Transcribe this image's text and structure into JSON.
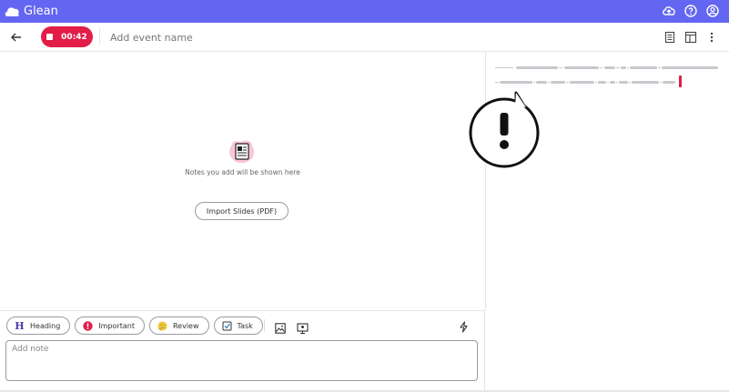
{
  "app": {
    "name": "Glean",
    "brand_color": "#6366f1"
  },
  "topbar": {
    "icons": [
      "cloud-upload-icon",
      "help-icon",
      "account-icon"
    ]
  },
  "toolbar": {
    "recording_time": "00:42",
    "recording_color": "#e11d48",
    "event_placeholder": "Add event name",
    "icons": [
      "back-arrow-icon",
      "notes-panel-icon",
      "layout-icon",
      "more-icon"
    ]
  },
  "notes": {
    "empty_message": "Notes you add will be shown here",
    "import_label": "Import Slides (PDF)"
  },
  "composer": {
    "chips": [
      {
        "label": "Heading",
        "icon": "heading-icon"
      },
      {
        "label": "Important",
        "icon": "important-icon"
      },
      {
        "label": "Review",
        "icon": "thinking-face-icon"
      },
      {
        "label": "Task",
        "icon": "task-checkbox-icon"
      }
    ],
    "note_placeholder": "Add note"
  }
}
